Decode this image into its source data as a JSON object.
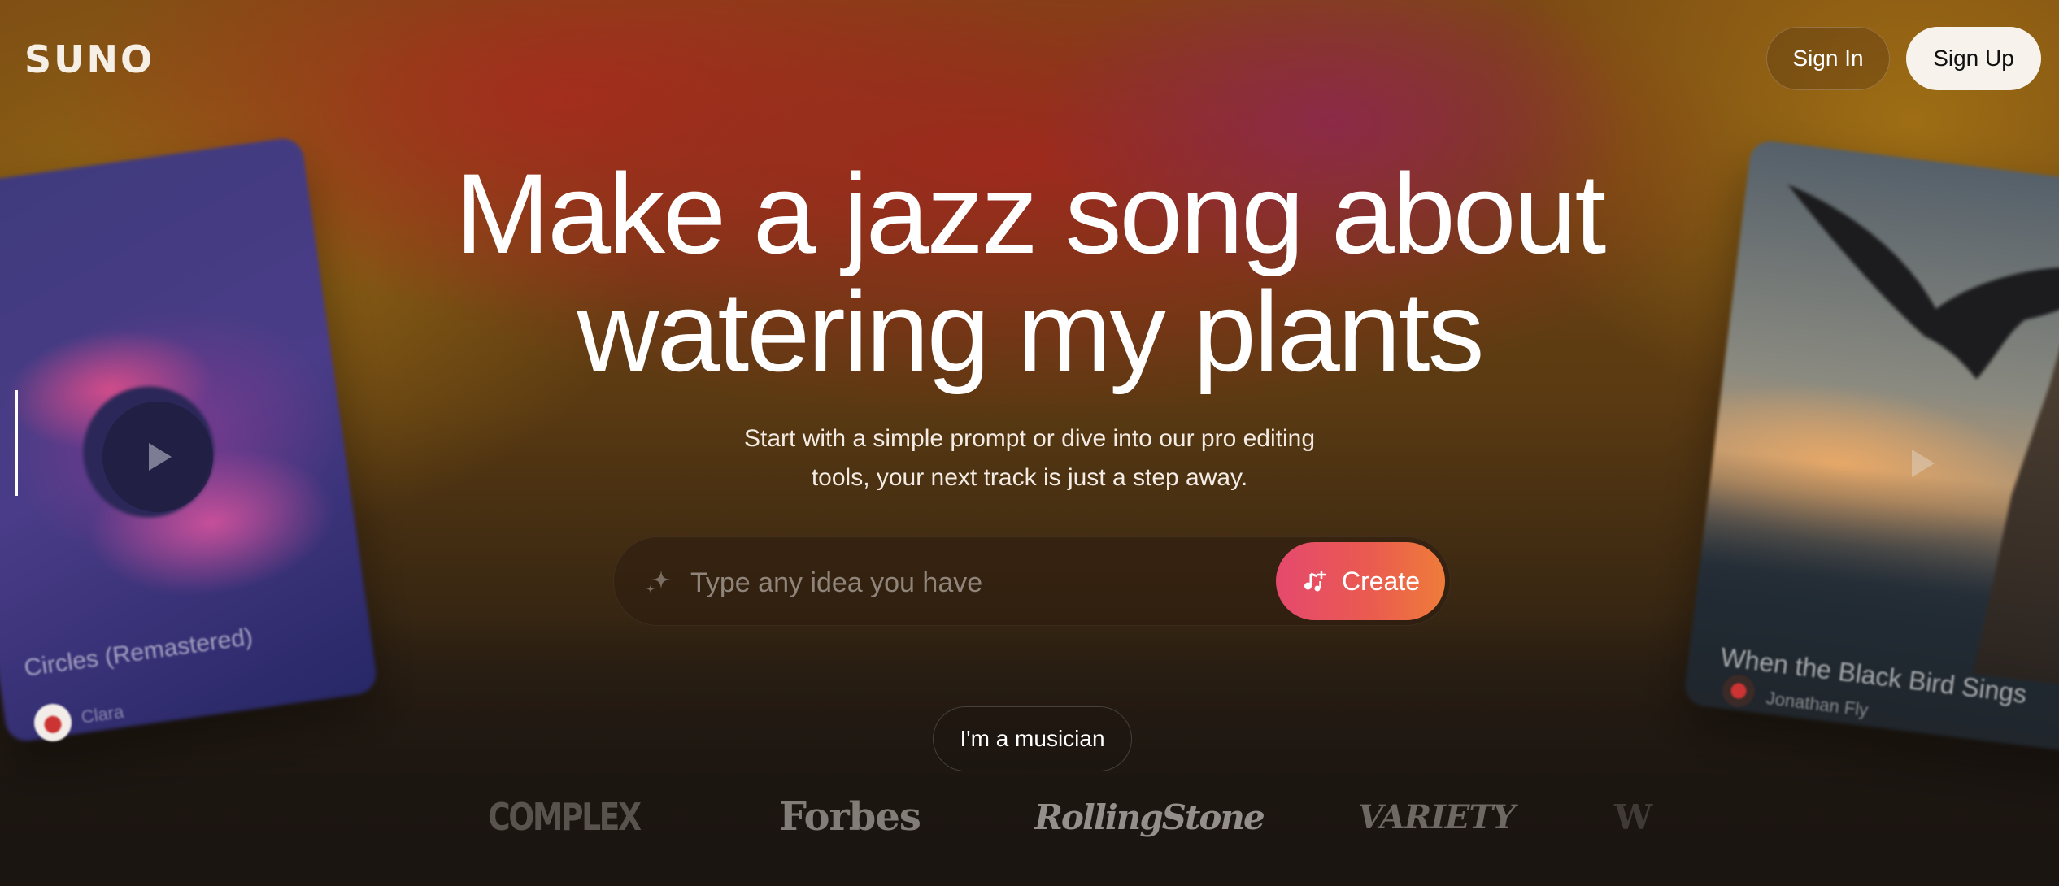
{
  "brand": {
    "logo_text": "SUNO"
  },
  "header": {
    "sign_in_label": "Sign In",
    "sign_up_label": "Sign Up"
  },
  "hero": {
    "title_line1": "Make a jazz song about",
    "title_line2": "watering my plants",
    "subtitle_line1": "Start with a simple prompt or dive into our pro editing",
    "subtitle_line2": "tools, your next track is just a step away."
  },
  "prompt": {
    "placeholder": "Type any idea you have",
    "value": "",
    "create_label": "Create",
    "sparkle_icon": "sparkle-icon",
    "create_icon": "music-note-plus-icon"
  },
  "musician_label": "I'm a musician",
  "press_logos": [
    "COMPLEX",
    "Forbes",
    "RollingStone",
    "VARIETY",
    "W"
  ],
  "cards": {
    "left": {
      "title": "Circles (Remastered)",
      "artist": "Clara",
      "icon": "play-icon"
    },
    "right": {
      "title": "When the Black Bird Sings",
      "artist": "Jonathan Fly",
      "icon": "play-icon"
    }
  },
  "colors": {
    "create_gradient_start": "#e5496e",
    "create_gradient_end": "#ef7c3a",
    "sign_up_bg": "#f7f3ec"
  }
}
